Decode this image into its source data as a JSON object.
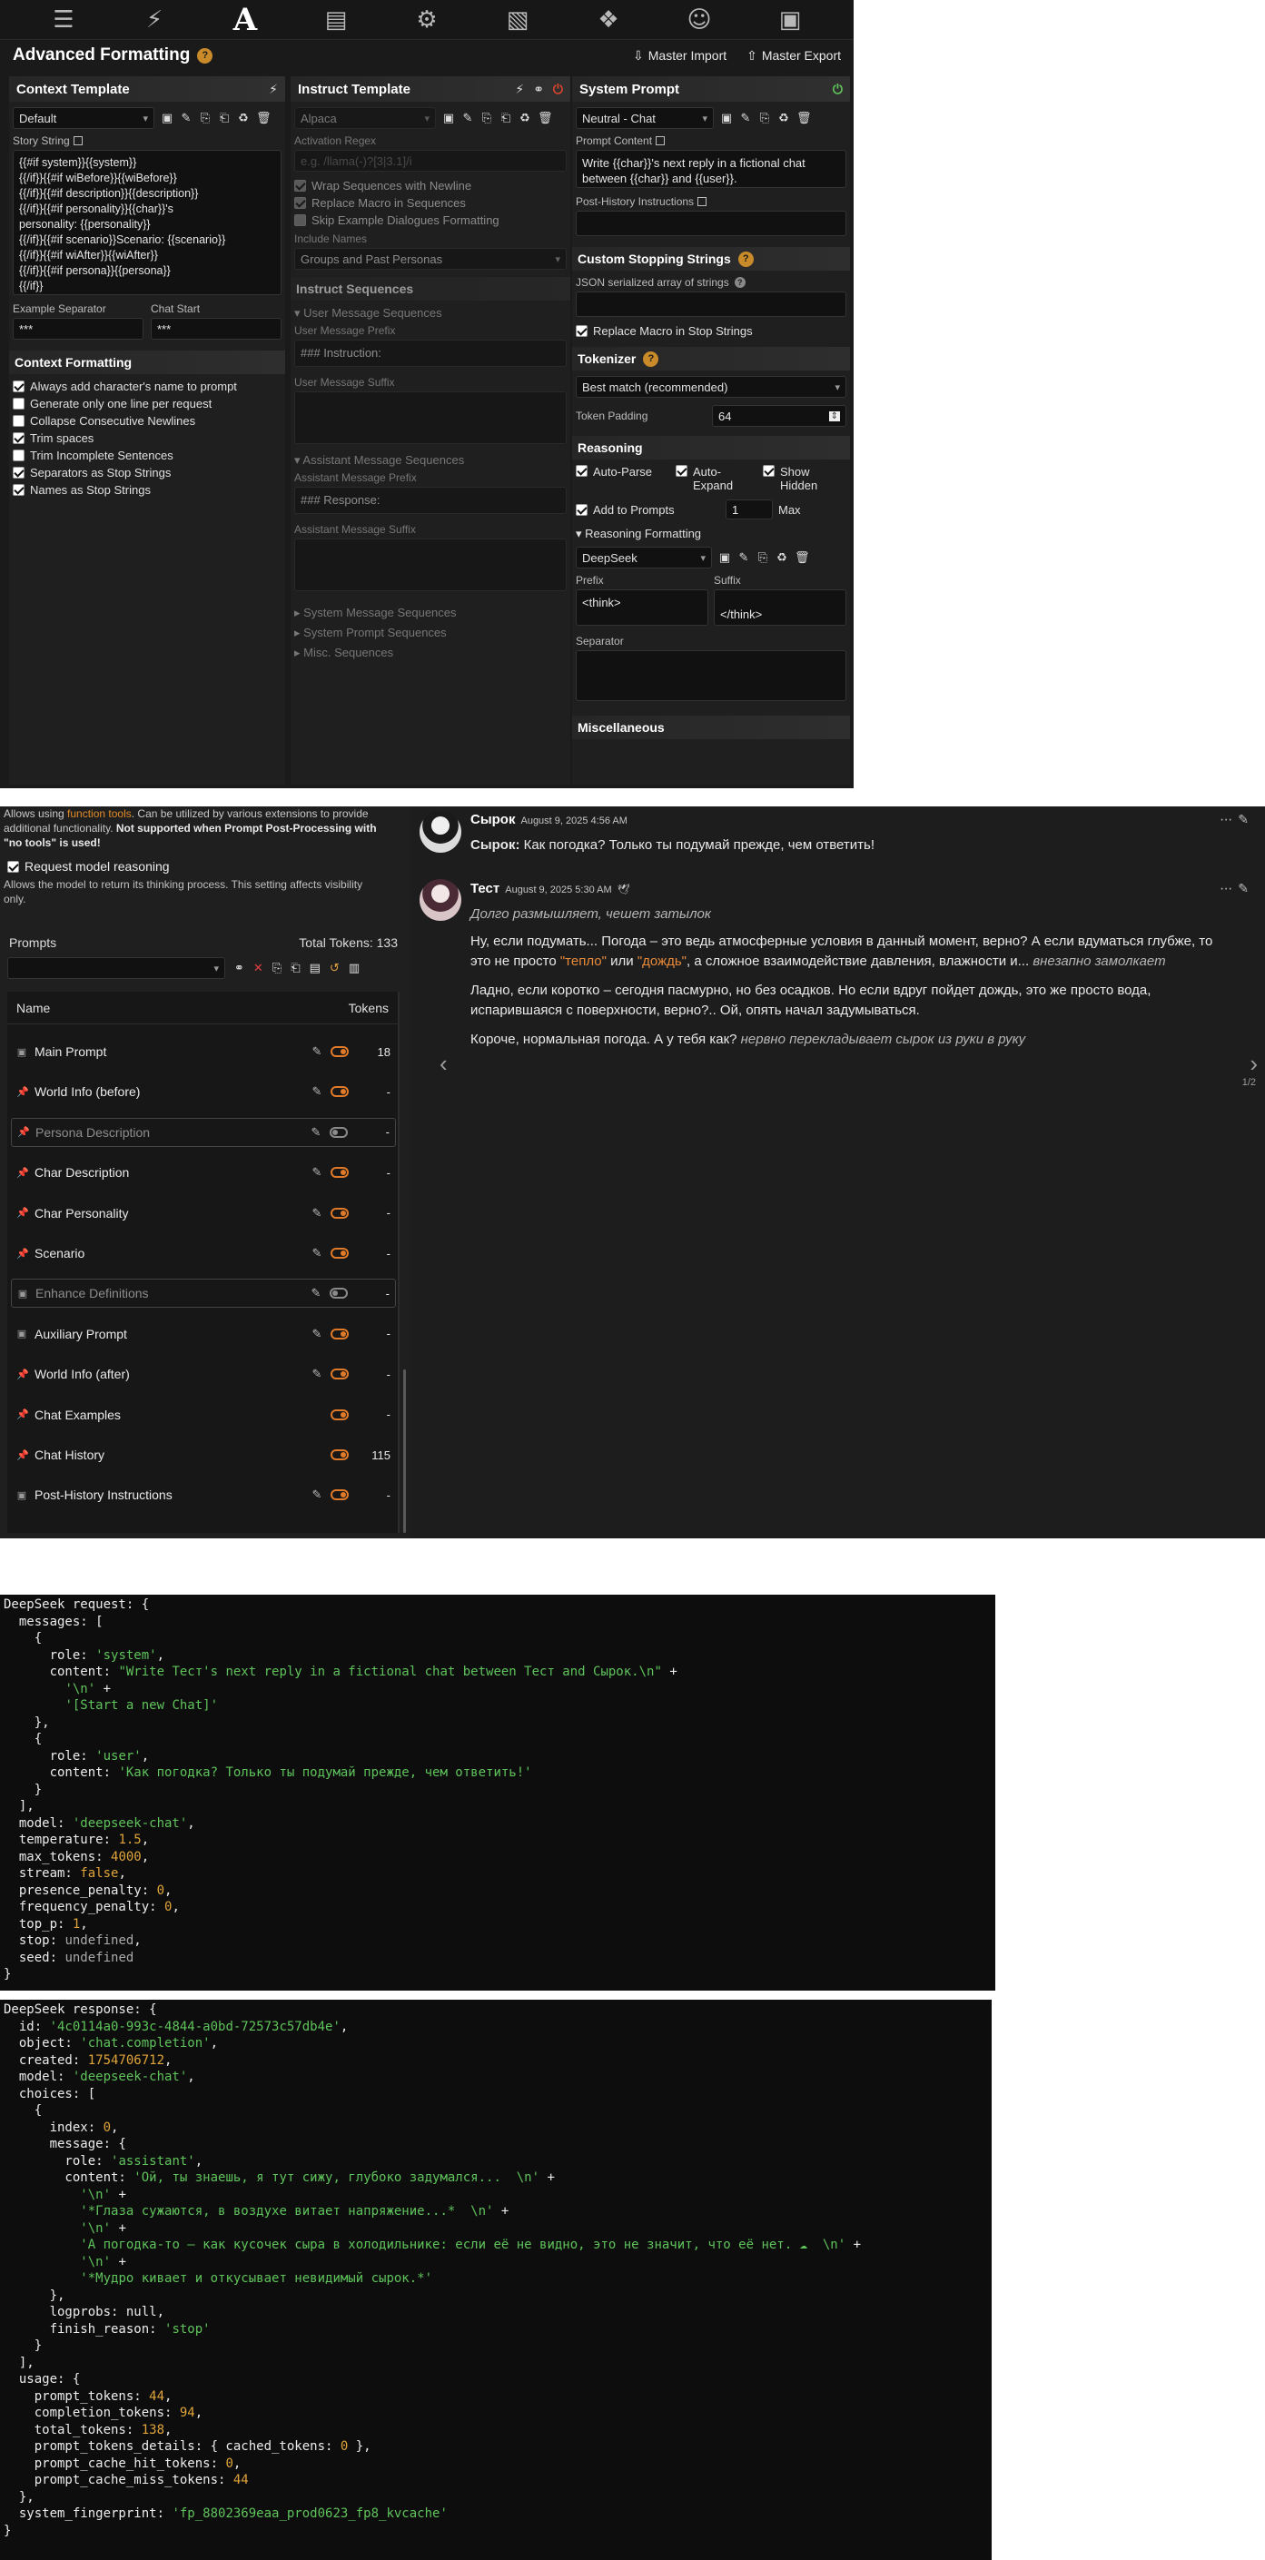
{
  "nav": {
    "icons": [
      "sliders-icon",
      "plug-icon",
      "font-icon",
      "book-icon",
      "user-cog-icon",
      "image-icon",
      "cubes-icon",
      "smile-icon",
      "id-card-icon"
    ]
  },
  "advanced_formatting": {
    "title": "Advanced Formatting",
    "master_import": "Master Import",
    "master_export": "Master Export"
  },
  "context_template": {
    "title": "Context Template",
    "preset": "Default",
    "story_string_label": "Story String",
    "story_string": "{{#if system}}{{system}}\n{{/if}}{{#if wiBefore}}{{wiBefore}}\n{{/if}}{{#if description}}{{description}}\n{{/if}}{{#if personality}}{{char}}'s\npersonality: {{personality}}\n{{/if}}{{#if scenario}}Scenario: {{scenario}}\n{{/if}}{{#if wiAfter}}{{wiAfter}}\n{{/if}}{{#if persona}}{{persona}}\n{{/if}}",
    "example_separator_label": "Example Separator",
    "example_separator": "***",
    "chat_start_label": "Chat Start",
    "chat_start": "***",
    "formatting_title": "Context Formatting",
    "checkboxes": [
      {
        "label": "Always add character's name to prompt",
        "checked": true
      },
      {
        "label": "Generate only one line per request",
        "checked": false
      },
      {
        "label": "Collapse Consecutive Newlines",
        "checked": false
      },
      {
        "label": "Trim spaces",
        "checked": true
      },
      {
        "label": "Trim Incomplete Sentences",
        "checked": false
      },
      {
        "label": "Separators as Stop Strings",
        "checked": true
      },
      {
        "label": "Names as Stop Strings",
        "checked": true
      }
    ]
  },
  "instruct_template": {
    "title": "Instruct Template",
    "preset": "Alpaca",
    "activation_regex_label": "Activation Regex",
    "activation_regex_placeholder": "e.g. /llama(-)?[3|3.1]/i",
    "checkboxes": [
      {
        "label": "Wrap Sequences with Newline",
        "checked": true
      },
      {
        "label": "Replace Macro in Sequences",
        "checked": true
      },
      {
        "label": "Skip Example Dialogues Formatting",
        "checked": false
      }
    ],
    "include_names_label": "Include Names",
    "include_names": "Groups and Past Personas",
    "sequences_title": "Instruct Sequences",
    "user_sequences": "User Message Sequences",
    "user_prefix_label": "User Message Prefix",
    "user_prefix": "### Instruction:",
    "user_suffix_label": "User Message Suffix",
    "assistant_sequences": "Assistant Message Sequences",
    "assistant_prefix_label": "Assistant Message Prefix",
    "assistant_prefix": "### Response:",
    "assistant_suffix_label": "Assistant Message Suffix",
    "system_sequences": "System Message Sequences",
    "system_prompt_sequences": "System Prompt Sequences",
    "misc_sequences": "Misc. Sequences"
  },
  "system_prompt": {
    "title": "System Prompt",
    "preset": "Neutral - Chat",
    "content_label": "Prompt Content",
    "content": "Write {{char}}'s next reply in a fictional chat between {{char}} and {{user}}.",
    "post_history_label": "Post-History Instructions",
    "stopping_title": "Custom Stopping Strings",
    "json_label": "JSON serialized array of strings",
    "replace_macro_stop": "Replace Macro in Stop Strings",
    "tokenizer_title": "Tokenizer",
    "tokenizer": "Best match (recommended)",
    "token_padding_label": "Token Padding",
    "token_padding": "64",
    "reasoning_title": "Reasoning",
    "auto_parse": "Auto-Parse",
    "auto_expand": "Auto-Expand",
    "show_hidden": "Show Hidden",
    "add_to_prompts": "Add to Prompts",
    "max_additions": "1",
    "max_label": "Max",
    "reasoning_formatting": "Reasoning Formatting",
    "reasoning_preset": "DeepSeek",
    "prefix_label": "Prefix",
    "prefix": "<think>",
    "suffix_label": "Suffix",
    "suffix": "</think>",
    "separator_label": "Separator",
    "misc_title": "Miscellaneous"
  },
  "function_tools": {
    "note_pre": "Allows using ",
    "note_link": "function tools",
    "note_mid": ". Can be utilized by various extensions to provide additional functionality. ",
    "note_bold": "Not supported when Prompt Post-Processing with \"no tools\" is used!",
    "reasoning_label": "Request model reasoning",
    "reasoning_sub": "Allows the model to return its thinking process. This setting affects visibility only."
  },
  "prompts": {
    "title": "Prompts",
    "total_tokens": "Total Tokens: 133",
    "col_name": "Name",
    "col_tokens": "Tokens",
    "rows": [
      {
        "name": "Main Prompt",
        "tokens": "18",
        "enabled": true,
        "editable": true,
        "icon": "square"
      },
      {
        "name": "World Info (before)",
        "tokens": "-",
        "enabled": true,
        "editable": true,
        "icon": "pin"
      },
      {
        "name": "Persona Description",
        "tokens": "-",
        "enabled": false,
        "editable": true,
        "icon": "pin"
      },
      {
        "name": "Char Description",
        "tokens": "-",
        "enabled": true,
        "editable": true,
        "icon": "pin"
      },
      {
        "name": "Char Personality",
        "tokens": "-",
        "enabled": true,
        "editable": true,
        "icon": "pin"
      },
      {
        "name": "Scenario",
        "tokens": "-",
        "enabled": true,
        "editable": true,
        "icon": "pin"
      },
      {
        "name": "Enhance Definitions",
        "tokens": "-",
        "enabled": false,
        "editable": true,
        "icon": "square"
      },
      {
        "name": "Auxiliary Prompt",
        "tokens": "-",
        "enabled": true,
        "editable": true,
        "icon": "square"
      },
      {
        "name": "World Info (after)",
        "tokens": "-",
        "enabled": true,
        "editable": true,
        "icon": "pin"
      },
      {
        "name": "Chat Examples",
        "tokens": "-",
        "enabled": true,
        "editable": false,
        "icon": "pin"
      },
      {
        "name": "Chat History",
        "tokens": "115",
        "enabled": true,
        "editable": false,
        "icon": "pin"
      },
      {
        "name": "Post-History Instructions",
        "tokens": "-",
        "enabled": true,
        "editable": true,
        "icon": "square"
      }
    ]
  },
  "chat": {
    "msg1": {
      "name": "Сырок",
      "time": "August 9, 2025 4:56 AM",
      "speaker": "Сырок:",
      "text": " Как погодка? Только ты подумай прежде, чем ответить!"
    },
    "msg2": {
      "name": "Тест",
      "time": "August 9, 2025 5:30 AM",
      "line1": "Долго размышляет, чешет затылок",
      "p1a": "Ну, если подумать... Погода – это ведь атмосферные условия в данный момент, верно? А если вдуматься глубже, то это не просто ",
      "p1q1": "\"тепло\"",
      "p1b": " или ",
      "p1q2": "\"дождь\"",
      "p1c": ", а сложное взаимодействие давления, влажности и... ",
      "p1i": "внезапно замолкает",
      "p2": "Ладно, если коротко – сегодня пасмурно, но без осадков. Но если вдруг пойдет дождь, это же просто вода, испарившаяся с поверхности, верно?.. Ой, опять начал задумываться.",
      "p3a": "Короче, нормальная погода. А у тебя как? ",
      "p3i": "нервно перекладывает сырок из руки в руку"
    },
    "swipe_counter": "1/2"
  }
}
